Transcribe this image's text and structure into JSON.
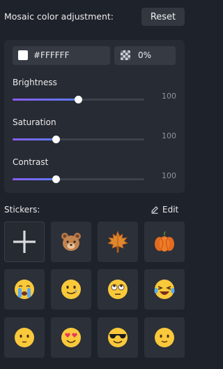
{
  "header": {
    "title": "Mosaic color adjustment:",
    "reset_label": "Reset"
  },
  "color": {
    "swatch": "#FFFFFF",
    "hex_label": "#FFFFFF",
    "opacity_label": "0%"
  },
  "sliders": [
    {
      "label": "Brightness",
      "value": "100",
      "level": 0.5
    },
    {
      "label": "Saturation",
      "value": "100",
      "level": 0.33
    },
    {
      "label": "Contrast",
      "value": "100",
      "level": 0.33
    }
  ],
  "stickers": {
    "title": "Stickers:",
    "edit_label": "Edit",
    "items": [
      {
        "icon": "add-icon"
      },
      {
        "icon": "bear-sticker"
      },
      {
        "icon": "maple-leaf-sticker"
      },
      {
        "icon": "pumpkin-sticker"
      },
      {
        "icon": "crying-face-sticker"
      },
      {
        "icon": "tearful-smile-sticker"
      },
      {
        "icon": "eye-roll-face-sticker"
      },
      {
        "icon": "laughing-tears-sticker"
      },
      {
        "icon": "neutral-face-sticker"
      },
      {
        "icon": "heart-eyes-sticker"
      },
      {
        "icon": "sunglasses-face-sticker"
      },
      {
        "icon": "smiling-face-sticker"
      }
    ]
  },
  "colors": {
    "accent_start": "#8a5cf6",
    "accent_end": "#5b7cfa",
    "background": "#1e222a"
  }
}
